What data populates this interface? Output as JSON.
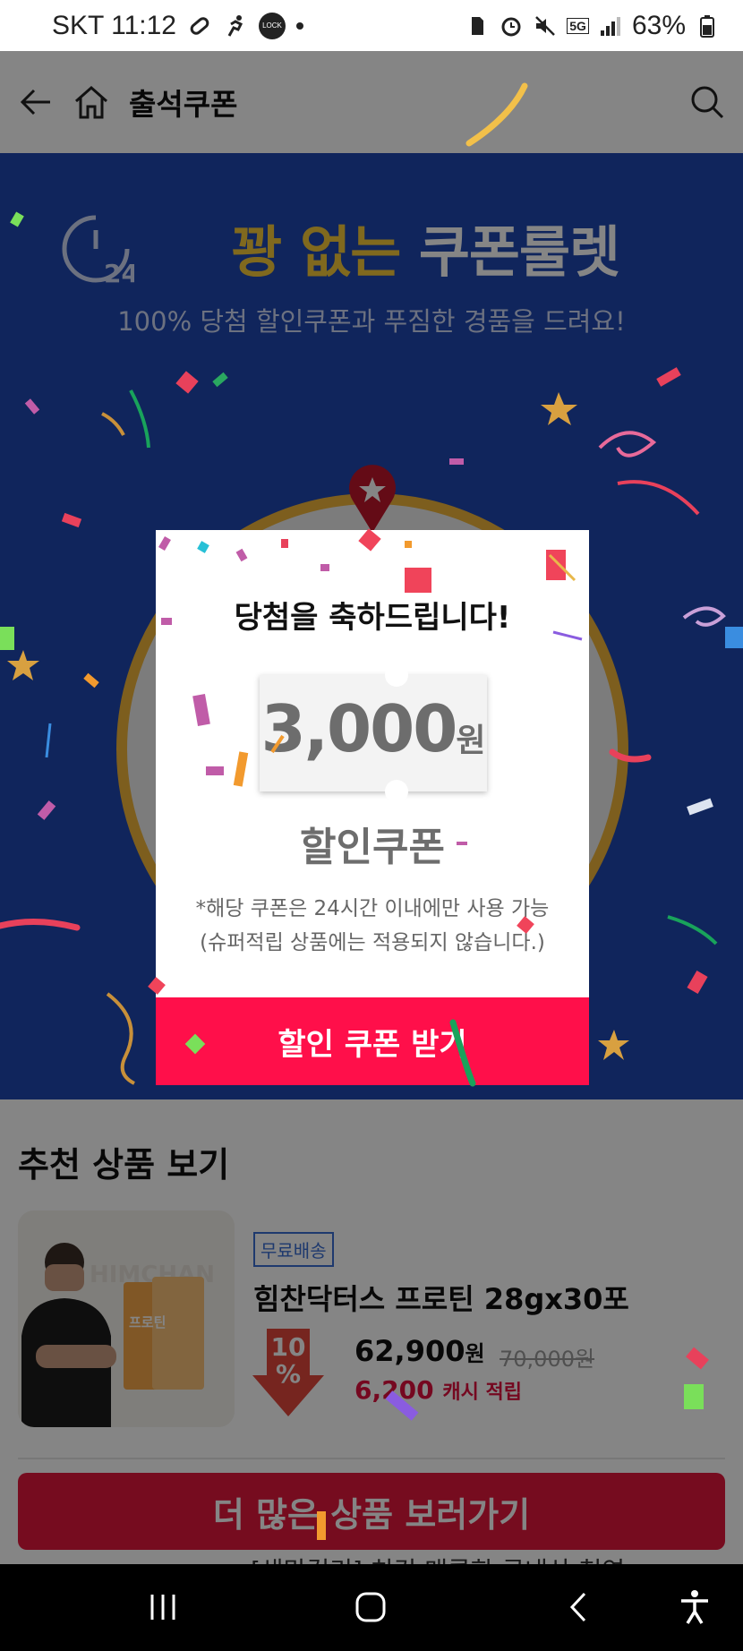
{
  "status_bar": {
    "carrier_time": "SKT 11:12",
    "lock_badge": "LOCK",
    "network": "5G",
    "battery": "63%",
    "icons": [
      "link-icon",
      "running-icon",
      "lock-badge-icon",
      "sim-icon",
      "alarm-icon",
      "mute-icon",
      "signal-icon",
      "battery-icon"
    ]
  },
  "header": {
    "title": "출석쿠폰",
    "icons": [
      "back-arrow-icon",
      "home-icon",
      "search-icon"
    ]
  },
  "banner": {
    "clock_label": "24",
    "headline_yellow": "꽝 없는",
    "headline_white": "쿠폰룰렛",
    "subline": "100% 당첨 할인쿠폰과 푸짐한 경품을 드려요!",
    "colors": {
      "background": "#1f47b0",
      "accent": "#f6c93a",
      "wheel_rim": "#f0b43a",
      "pin": "#c0162b"
    }
  },
  "popup": {
    "title": "당첨을 축하드립니다!",
    "amount": "3,000",
    "amount_unit": "원",
    "coupon_label": "할인쿠폰",
    "note_line1": "*해당 쿠폰은 24시간 이내에만 사용 가능",
    "note_line2": "(슈퍼적립 상품에는 적용되지 않습니다.)",
    "cta": "할인 쿠폰 받기",
    "colors": {
      "cta": "#ff0f4a"
    }
  },
  "recommendations": {
    "title": "추천 상품 보기",
    "product": {
      "badge": "무료배송",
      "name": "힘찬닥터스 프로틴 28gx30포",
      "discount_value": "10",
      "discount_unit": "%",
      "price": "62,900",
      "price_unit": "원",
      "original_price": "70,000원",
      "cash_amount": "6,200",
      "cash_label": "캐시 적립",
      "package_brand": "HIMCHAN",
      "package_label": "프로틴"
    },
    "more_button": "더 많은 상품 보러가기",
    "next_item_peek": "[생막걸리] 치킨 매콤한 국내산 천연"
  },
  "nav_bar": {
    "icons": [
      "recent-apps-icon",
      "home-button-icon",
      "back-icon",
      "accessibility-icon"
    ]
  }
}
